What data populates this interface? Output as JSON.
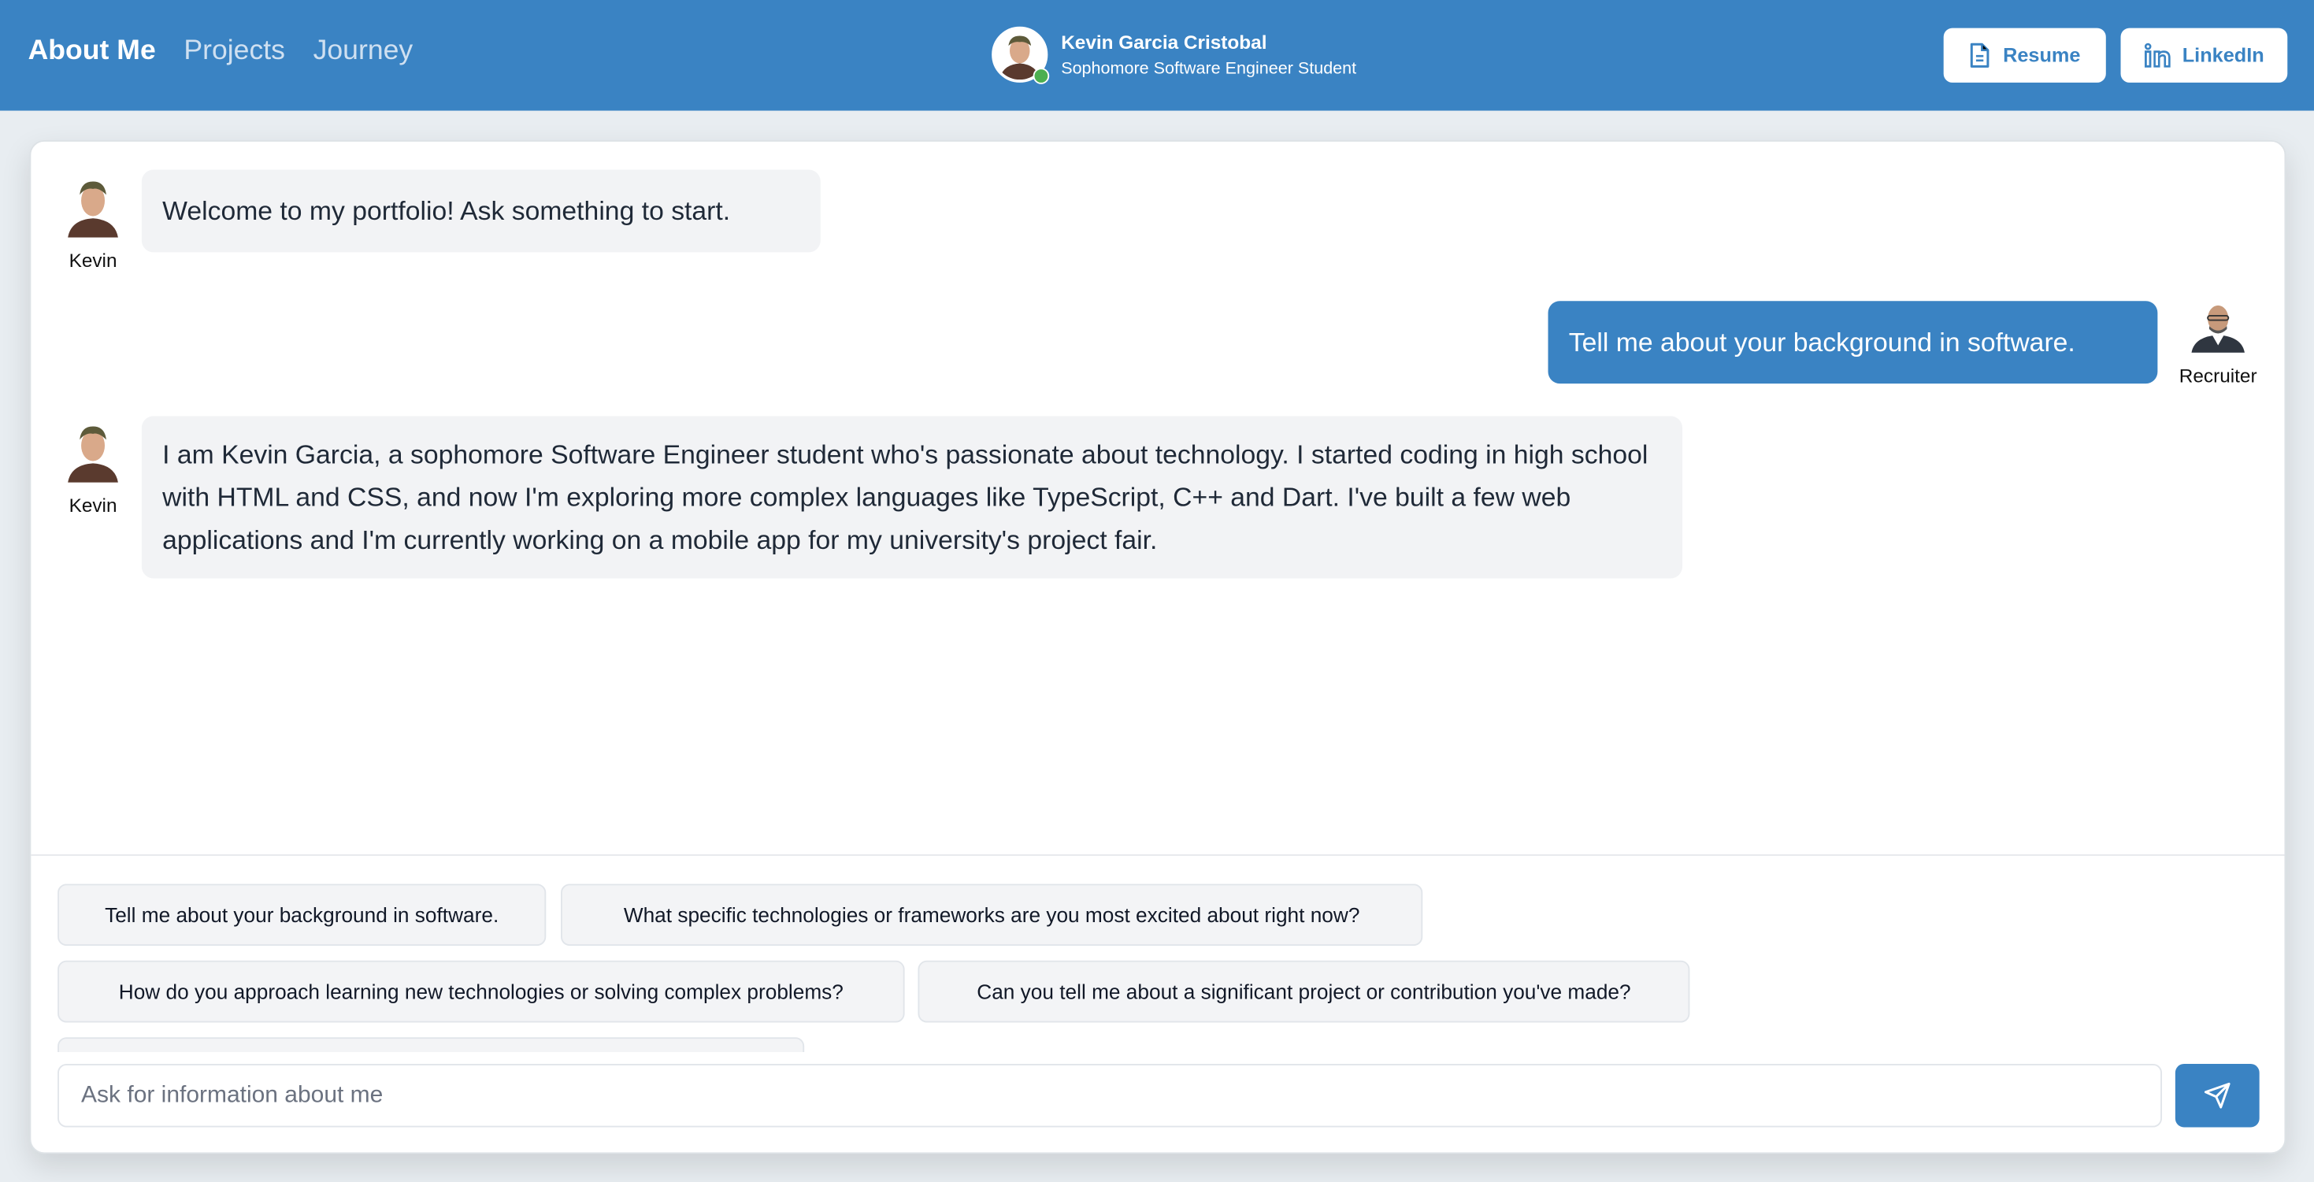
{
  "colors": {
    "brand": "#3a83c3",
    "bot_bubble": "#f2f3f5",
    "online": "#4caf50"
  },
  "nav": {
    "items": [
      {
        "label": "About Me",
        "active": true
      },
      {
        "label": "Projects",
        "active": false
      },
      {
        "label": "Journey",
        "active": false
      }
    ]
  },
  "profile": {
    "name": "Kevin Garcia Cristobal",
    "subtitle": "Sophomore Software Engineer Student",
    "status": "online"
  },
  "header_buttons": {
    "resume": {
      "label": "Resume",
      "icon": "document-icon"
    },
    "linkedin": {
      "label": "LinkedIn",
      "icon": "linkedin-icon"
    }
  },
  "messages": [
    {
      "sender": "Kevin",
      "role": "bot",
      "text": "Welcome to my portfolio! Ask something to start."
    },
    {
      "sender": "Recruiter",
      "role": "user",
      "text": "Tell me about your background in software."
    },
    {
      "sender": "Kevin",
      "role": "bot",
      "text": "I am Kevin Garcia, a sophomore Software Engineer student who's passionate about technology. I started coding in high school with HTML and CSS, and now I'm exploring more complex languages like TypeScript, C++ and Dart. I've built a few web applications and I'm currently working on a mobile app for my university's project fair."
    }
  ],
  "suggestions": [
    "Tell me about your background in software.",
    "What specific technologies or frameworks are you most excited about right now?",
    "How do you approach learning new technologies or solving complex problems?",
    "Can you tell me about a significant project or contribution you've made?"
  ],
  "input": {
    "placeholder": "Ask for information about me",
    "value": ""
  },
  "send_button": {
    "icon": "send-icon"
  }
}
